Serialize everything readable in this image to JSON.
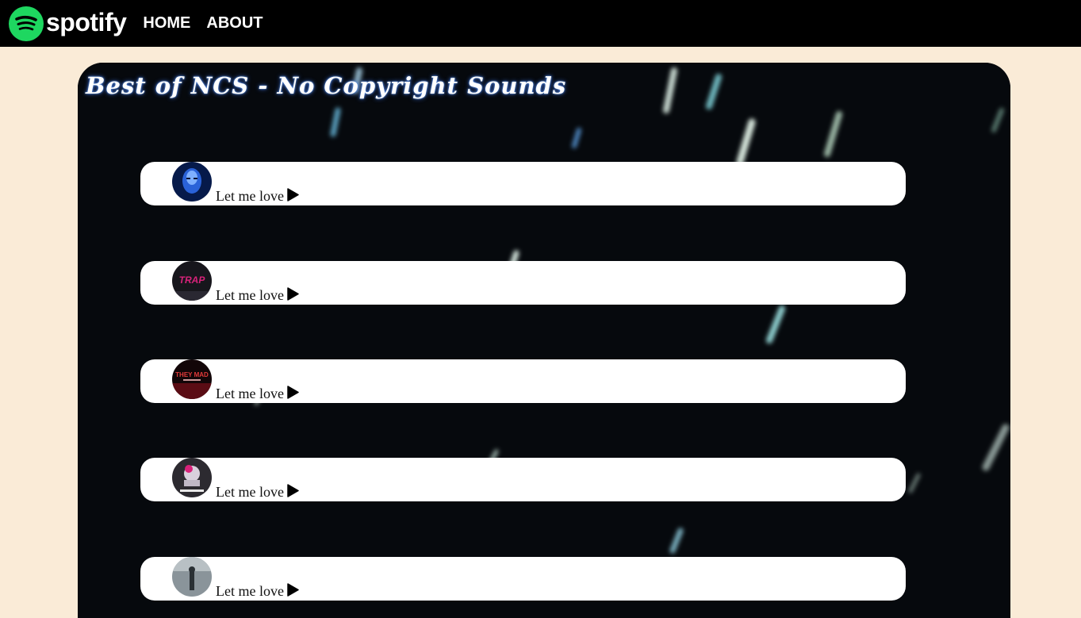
{
  "navbar": {
    "brand": "spotify",
    "links": [
      "HOME",
      "ABOUT"
    ]
  },
  "playlist": {
    "title": "Best of NCS - No Copyright Sounds",
    "songs": [
      {
        "title": "Let me love",
        "cover_icon": "blue-face-cover-art"
      },
      {
        "title": "Let me love",
        "cover_icon": "trap-cover-art"
      },
      {
        "title": "Let me love",
        "cover_icon": "they-mad-cover-art"
      },
      {
        "title": "Let me love",
        "cover_icon": "plug-walk-cover-art"
      },
      {
        "title": "Let me love",
        "cover_icon": "misty-figure-cover-art"
      }
    ]
  },
  "colors": {
    "page_background": "#faebd7",
    "navbar": "#000000",
    "spotify_green": "#1ed760",
    "song_card": "#ffffff"
  }
}
